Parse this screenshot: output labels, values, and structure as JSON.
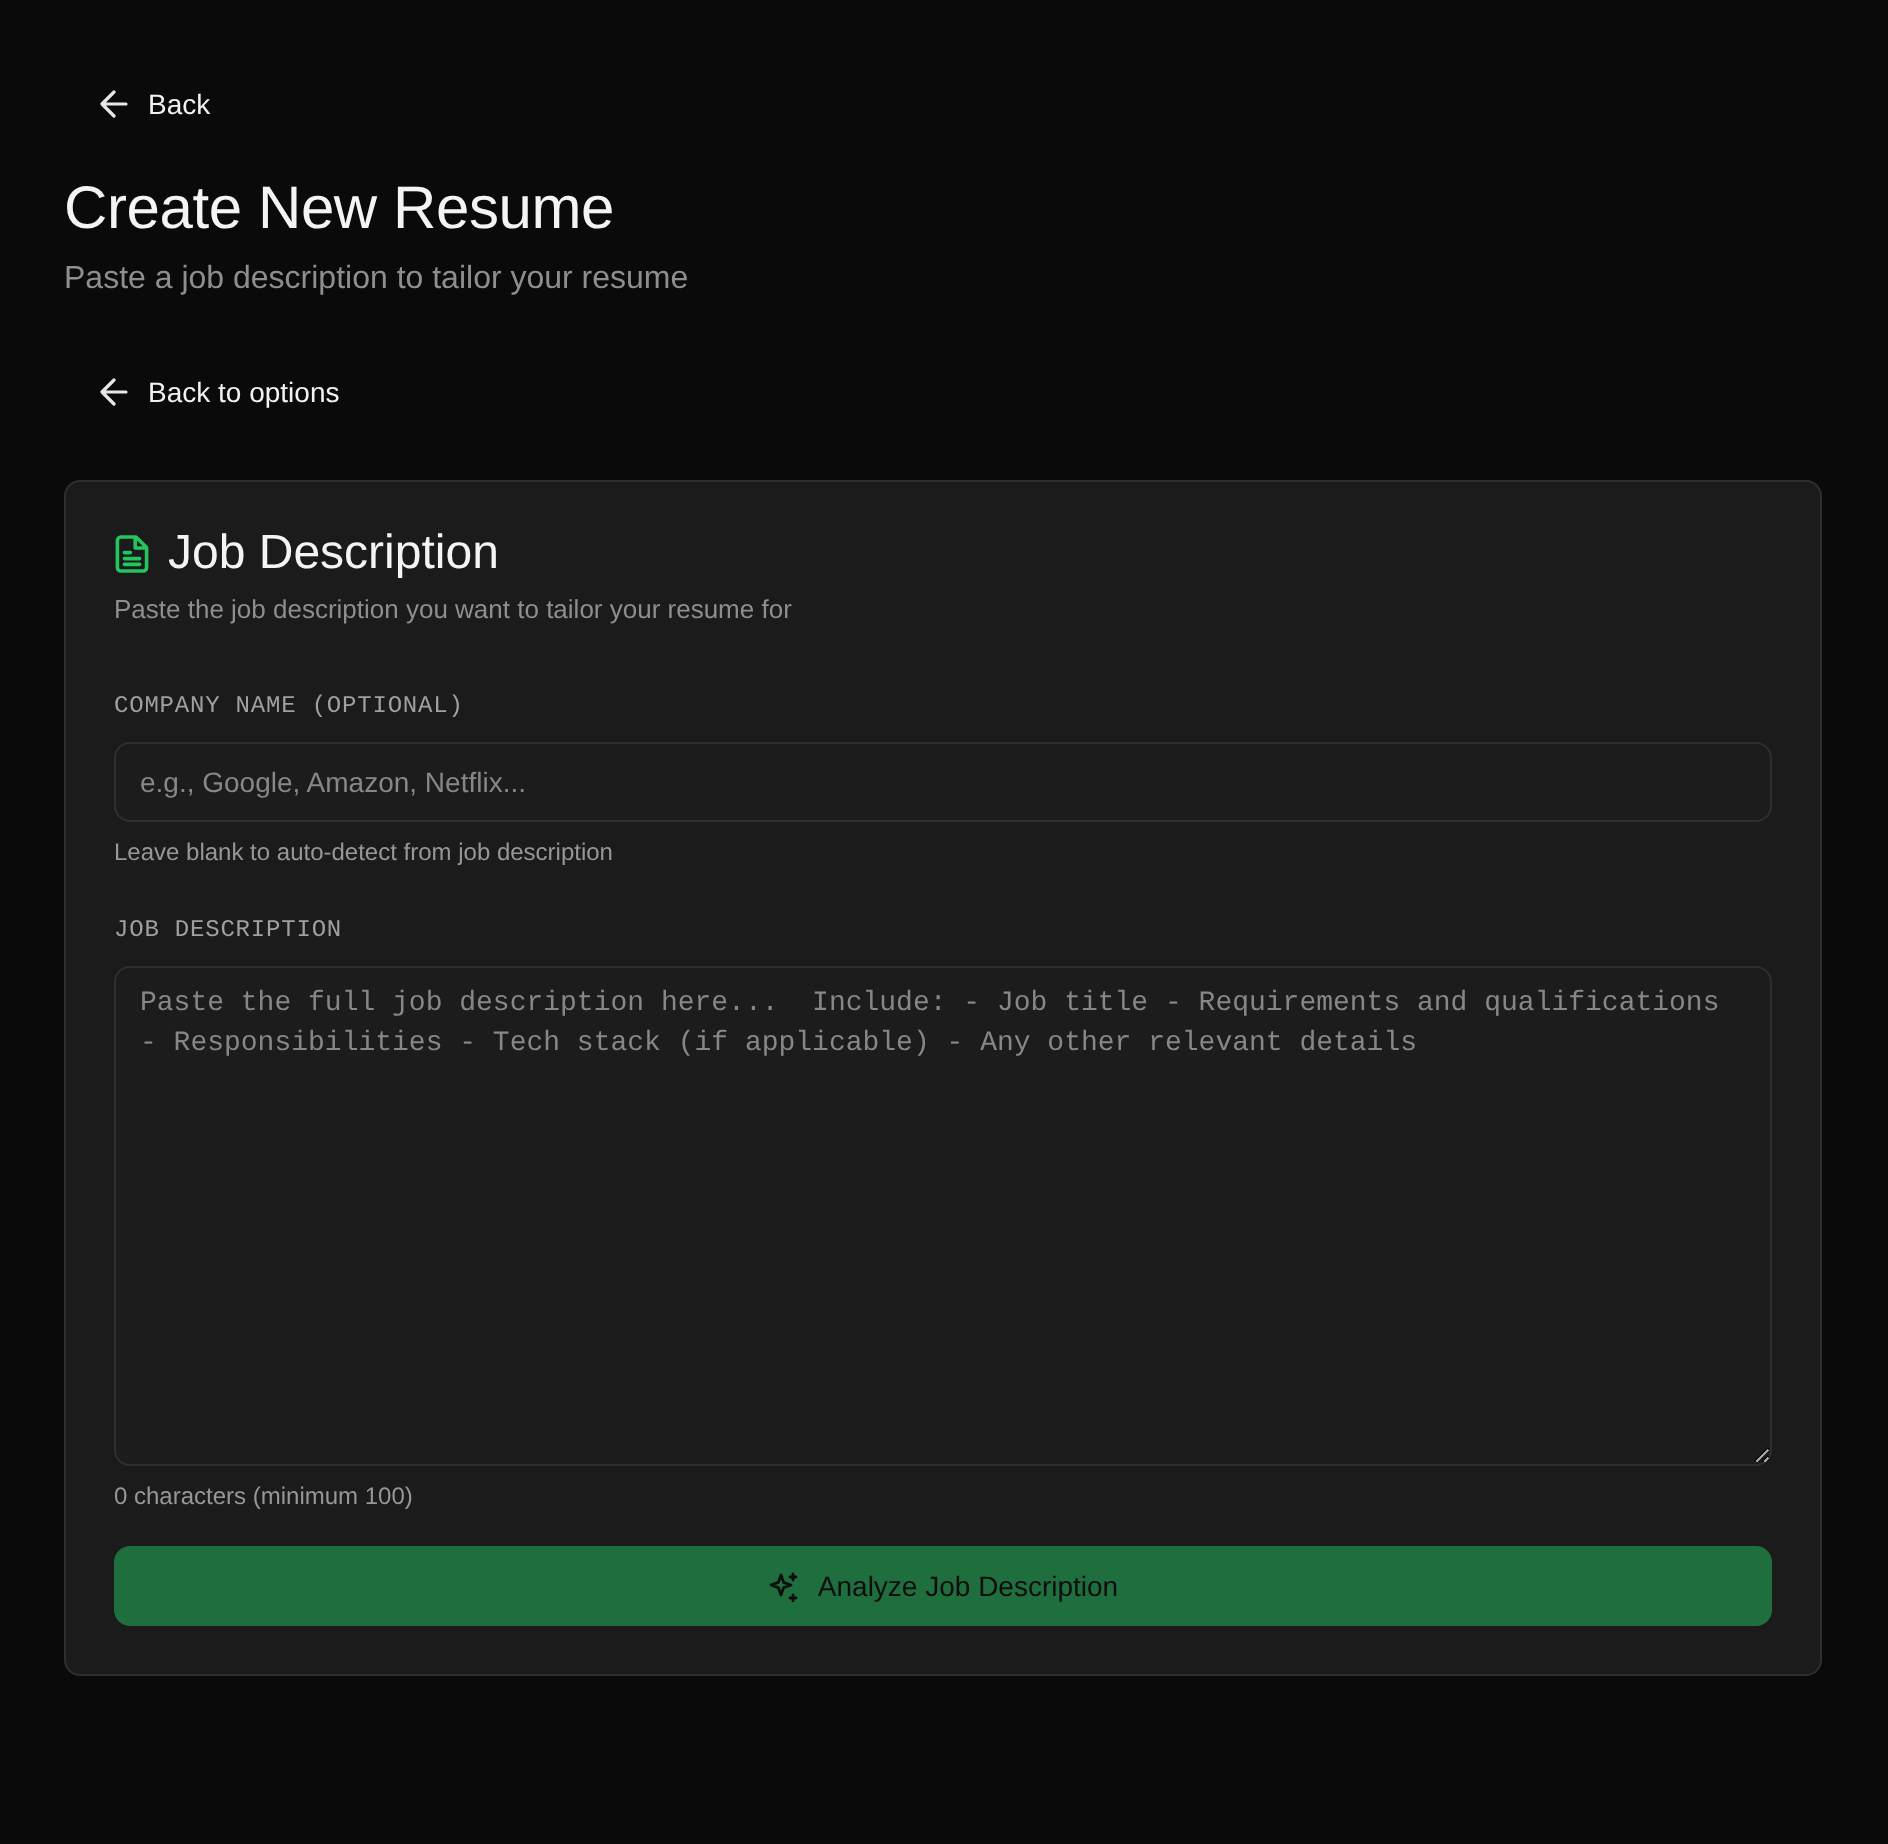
{
  "back_link": {
    "label": "Back"
  },
  "header": {
    "title": "Create New Resume",
    "subtitle": "Paste a job description to tailor your resume"
  },
  "back_to_options": {
    "label": "Back to options"
  },
  "card": {
    "title": "Job Description",
    "subtitle": "Paste the job description you want to tailor your resume for",
    "fields": [
      {
        "kind": "input",
        "label": "COMPANY NAME (OPTIONAL)",
        "placeholder": "e.g., Google, Amazon, Netflix...",
        "hint": "Leave blank to auto-detect from job description"
      },
      {
        "kind": "textarea",
        "label": "JOB DESCRIPTION",
        "placeholder": "Paste the full job description here...  Include: - Job title - Requirements and qualifications - Responsibilities - Tech stack (if applicable) - Any other relevant details",
        "hint": "0 characters (minimum 100)"
      }
    ],
    "submit": {
      "label": "Analyze Job Description",
      "disabled": true
    }
  }
}
